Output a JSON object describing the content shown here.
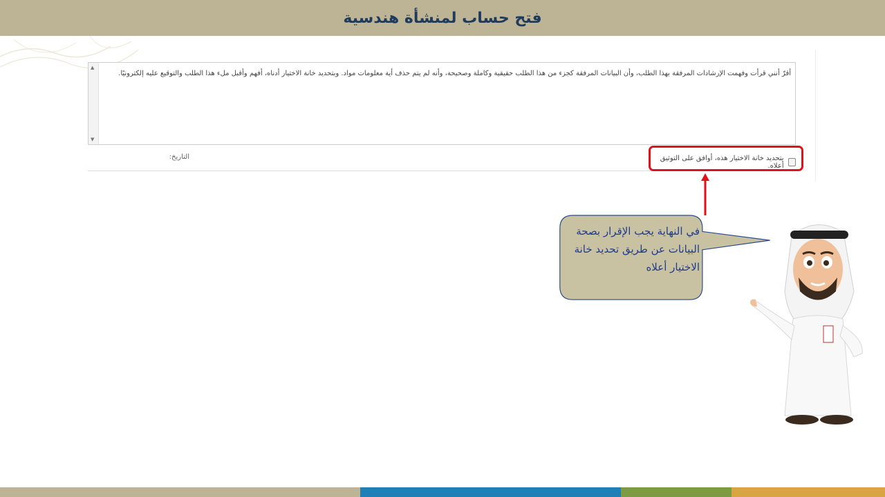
{
  "header": {
    "title": "فتح حساب لمنشأة هندسية"
  },
  "declaration": {
    "text": "أقرّ أنني قرأت وفهمت الإرشادات المرفقة بهذا الطلب، وأن البيانات المرفقة كجزء من هذا الطلب حقيقية وكاملة وصحيحة، وأنه لم يتم حذف أية معلومات مواد. وبتحديد خانة الاختيار أدناه، أفهم وأقبل ملء هذا الطلب والتوقيع عليه إلكترونيًا."
  },
  "consent": {
    "checkbox_label": "بتحديد خانة الاختيار هذه، أوافق على التوثيق أعلاه.",
    "checked": false
  },
  "date_label": "التاريخ:",
  "callout": {
    "text": "في النهاية يجب الإقرار بصحة البيانات عن طريق تحديد خانة الاختيار أعلاه"
  },
  "colors": {
    "header_bg": "#bdb496",
    "title_color": "#1f3b5c",
    "highlight_red": "#e0131b",
    "bubble_fill": "#c9c2a2",
    "bubble_stroke": "#2b4a8c",
    "callout_text": "#1f3b8c",
    "bottom_segments": [
      "#bdb496",
      "#1f80b5",
      "#7d9b43",
      "#d9a443"
    ]
  }
}
